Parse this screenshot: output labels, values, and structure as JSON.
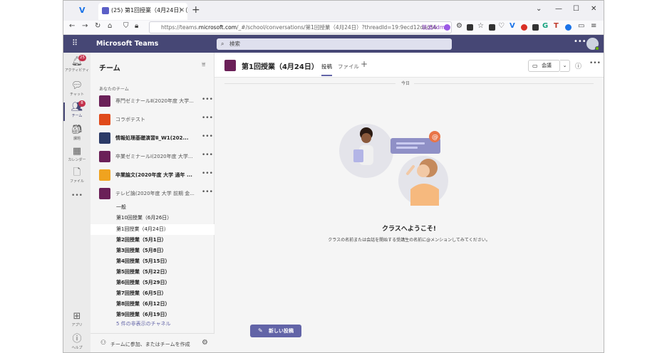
{
  "browser": {
    "tab_title": "(25) 第1回授業（4月24日）（ア",
    "url_prefix": "https://teams.",
    "url_domain": "microsoft.com",
    "url_rest": "/_#/school/conversations/第1回授業（4月24日）?threadId=19:9ecd12dad56",
    "profile_label": "筑波Admin"
  },
  "teams": {
    "app_name": "Microsoft Teams",
    "search_placeholder": "検索"
  },
  "rail": [
    {
      "label": "アクティビティ",
      "icon": "bell-icon",
      "badge": "25"
    },
    {
      "label": "チャット",
      "icon": "chat-icon",
      "badge": ""
    },
    {
      "label": "チーム",
      "icon": "teams-icon",
      "badge": "8"
    },
    {
      "label": "課題",
      "icon": "assignments-icon",
      "badge": ""
    },
    {
      "label": "カレンダー",
      "icon": "calendar-icon",
      "badge": ""
    },
    {
      "label": "ファイル",
      "icon": "files-icon",
      "badge": ""
    },
    {
      "label": "•••",
      "icon": "more-icon",
      "badge": ""
    },
    {
      "label": "アプリ",
      "icon": "apps-icon",
      "badge": ""
    },
    {
      "label": "ヘルプ",
      "icon": "help-icon",
      "badge": ""
    }
  ],
  "panel": {
    "title": "チーム",
    "section": "あなたのチーム",
    "teams": [
      {
        "name": "専門ゼミナールⅡ(2020年度 大学...",
        "color": "#6b2058",
        "bold": false
      },
      {
        "name": "コラボテスト",
        "color": "#e04a1b",
        "bold": false
      },
      {
        "name": "情報処理基礎演習Ⅱ_W1(202...",
        "color": "#2b3a67",
        "bold": true
      },
      {
        "name": "卒業ゼミナールⅠ(2020年度 大学...",
        "color": "#6b2058",
        "bold": false
      },
      {
        "name": "卒業論文(2020年度 大学 通年 ...",
        "color": "#f0a31f",
        "bold": true
      },
      {
        "name": "テレビ論(2020年度 大学 前期 金...",
        "color": "#6b2058",
        "bold": false
      }
    ],
    "channels": [
      {
        "name": "一般",
        "bold": false,
        "selected": false
      },
      {
        "name": "第10回授業（6月26日）",
        "bold": false,
        "selected": false
      },
      {
        "name": "第1回授業（4月24日）",
        "bold": false,
        "selected": true
      },
      {
        "name": "第2回授業（5月1日）",
        "bold": true,
        "selected": false
      },
      {
        "name": "第3回授業（5月8日）",
        "bold": true,
        "selected": false
      },
      {
        "name": "第4回授業（5月15日）",
        "bold": true,
        "selected": false
      },
      {
        "name": "第5回授業（5月22日）",
        "bold": true,
        "selected": false
      },
      {
        "name": "第6回授業（5月29日）",
        "bold": true,
        "selected": false
      },
      {
        "name": "第7回授業（6月5日）",
        "bold": true,
        "selected": false
      },
      {
        "name": "第8回授業（6月12日）",
        "bold": true,
        "selected": false
      },
      {
        "name": "第9回授業（6月19日）",
        "bold": true,
        "selected": false
      }
    ],
    "hidden_channels": "5 件の非表示のチャネル",
    "footer": "チームに参加、またはチームを作成"
  },
  "channel": {
    "title": "第1回授業（4月24日）",
    "tab_posts": "投稿",
    "tab_files": "ファイル",
    "meet_label": "会議",
    "today_label": "今日",
    "welcome_title": "クラスへようこそ!",
    "welcome_text": "クラスの名前または会話を開始する受講生の名前に@メンションしてみてください。",
    "new_post_label": "新しい投稿"
  },
  "colors": {
    "brand": "#464775",
    "accent": "#6264a7"
  }
}
